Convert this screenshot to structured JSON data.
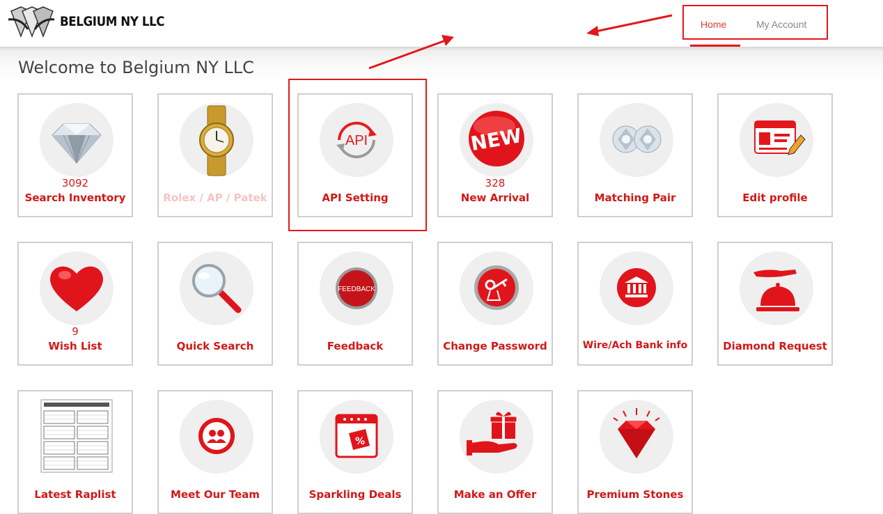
{
  "brand": {
    "name": "BELGIUM NY LLC"
  },
  "nav": {
    "home": "Home",
    "account": "My Account"
  },
  "page_title": "Welcome to Belgium NY LLC",
  "tiles": {
    "search_inventory": {
      "label": "Search Inventory",
      "count": "3092",
      "icon": "diamond-icon"
    },
    "rolex": {
      "label": "Rolex / AP / Patek",
      "icon": "watch-icon"
    },
    "api_setting": {
      "label": "API Setting",
      "icon": "api-icon",
      "icon_text": "API"
    },
    "new_arrival": {
      "label": "New Arrival",
      "count": "328",
      "icon": "new-badge-icon",
      "icon_text": "NEW"
    },
    "matching_pair": {
      "label": "Matching Pair",
      "icon": "diamond-pair-icon"
    },
    "edit_profile": {
      "label": "Edit profile",
      "icon": "profile-card-icon"
    },
    "wish_list": {
      "label": "Wish List",
      "count": "9",
      "icon": "heart-icon"
    },
    "quick_search": {
      "label": "Quick Search",
      "icon": "magnifier-icon"
    },
    "feedback": {
      "label": "Feedback",
      "icon": "feedback-icon",
      "icon_text": "FEEDBACK"
    },
    "change_password": {
      "label": "Change Password",
      "icon": "key-icon"
    },
    "wire_bank": {
      "label": "Wire/Ach Bank info",
      "icon": "bank-icon"
    },
    "diamond_request": {
      "label": "Diamond Request",
      "icon": "service-bell-icon"
    },
    "latest_raplist": {
      "label": "Latest Raplist",
      "icon": "raplist-document-icon"
    },
    "meet_team": {
      "label": "Meet Our Team",
      "icon": "team-icon"
    },
    "sparkling_deals": {
      "label": "Sparkling Deals",
      "icon": "calendar-discount-icon"
    },
    "make_offer": {
      "label": "Make an Offer",
      "icon": "gift-hand-icon"
    },
    "premium_stones": {
      "label": "Premium Stones",
      "icon": "gem-icon"
    }
  },
  "colors": {
    "accent": "#d21818",
    "annotation": "#e3171b",
    "faded_label": "#f4c4c4"
  }
}
